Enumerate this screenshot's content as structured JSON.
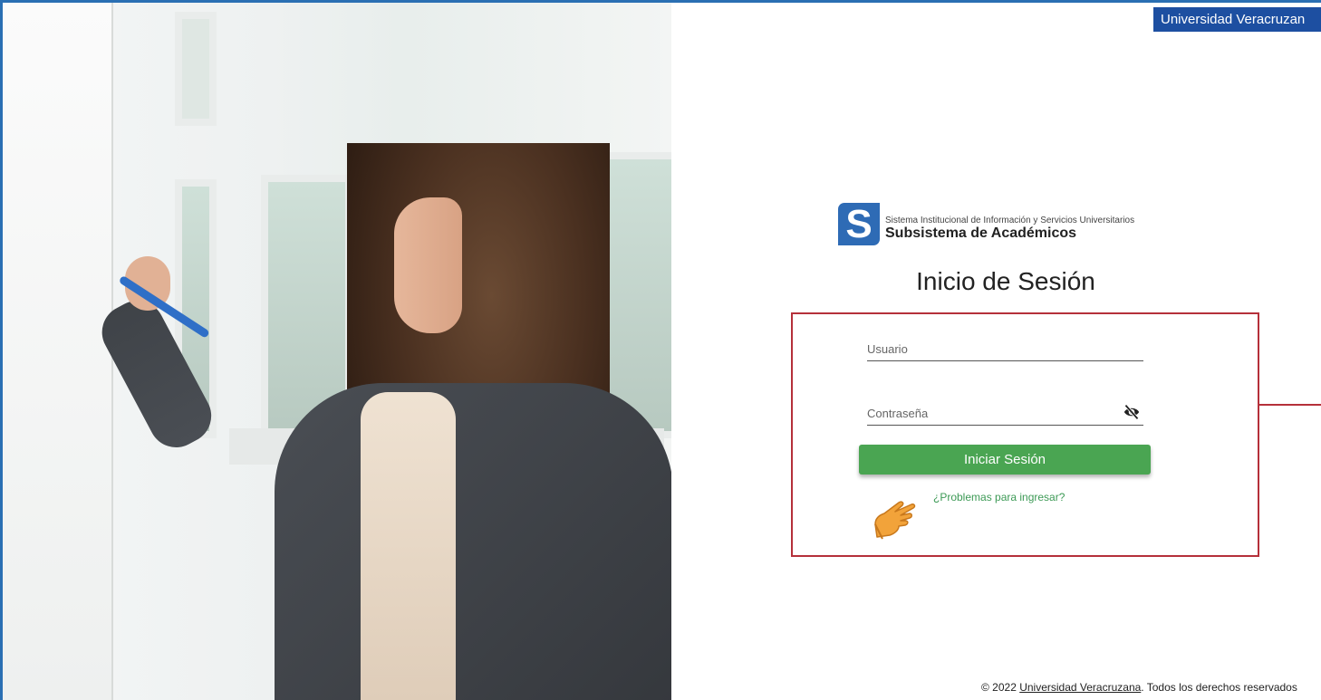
{
  "badge": {
    "label": "Universidad Veracruzan"
  },
  "logo": {
    "letter": "S",
    "system_name": "Sistema Institucional de Información y Servicios Universitarios",
    "subsystem_name": "Subsistema de Académicos",
    "color": "#2e6bb5"
  },
  "page_title": "Inicio de Sesión",
  "form": {
    "username_placeholder": "Usuario",
    "password_placeholder": "Contraseña",
    "username_value": "",
    "password_value": "",
    "password_toggle_icon": "eye-slash-icon",
    "submit_label": "Iniciar Sesión",
    "help_icon": "pointing-hand-icon",
    "help_link": "¿Problemas para ingresar?",
    "highlight_color": "#b5303a",
    "button_color": "#4aa552"
  },
  "footer": {
    "prefix": "© 2022 ",
    "link": "Universidad Veracruzana",
    "suffix": ". Todos los derechos reservados"
  }
}
